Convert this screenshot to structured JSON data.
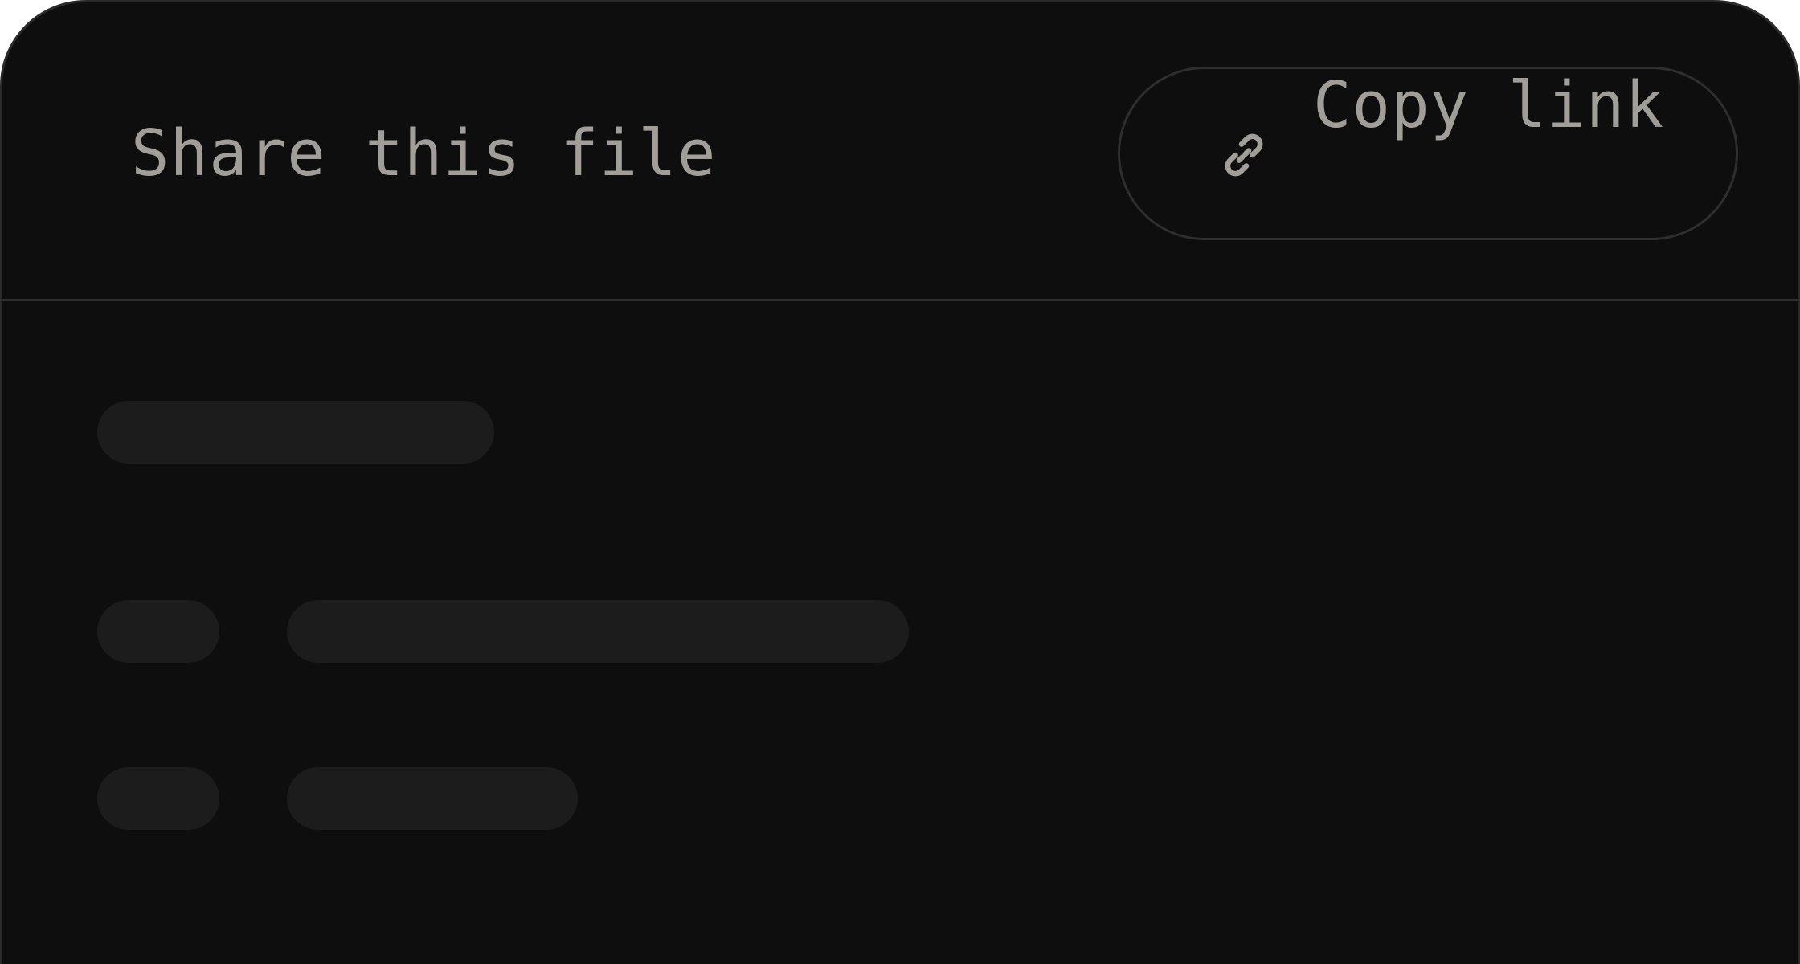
{
  "header": {
    "title": "Share this file",
    "copy_link": {
      "label": "Copy link",
      "icon": "link-icon"
    }
  },
  "colors": {
    "background": "#0e0e0e",
    "border": "#2d2d2d",
    "text": "#a19d98",
    "skeleton": "#1c1c1c"
  },
  "content": {
    "loading": true,
    "skeleton_rows": 3
  }
}
